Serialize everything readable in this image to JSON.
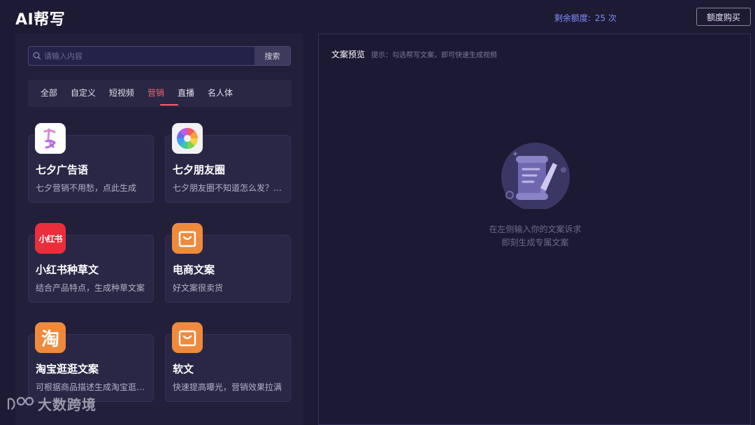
{
  "header": {
    "title": "AI帮写",
    "quota_label": "剩余额度:",
    "quota_value": "25 次",
    "buy_button": "额度购买"
  },
  "search": {
    "placeholder": "请输入内容",
    "button_label": "搜索"
  },
  "tabs": [
    {
      "label": "全部"
    },
    {
      "label": "自定义"
    },
    {
      "label": "短视频"
    },
    {
      "label": "营销",
      "active": true
    },
    {
      "label": "直播"
    },
    {
      "label": "名人体"
    }
  ],
  "cards": [
    {
      "title": "七夕广告语",
      "desc": "七夕营销不用愁，点此生成",
      "icon": "qixi-icon"
    },
    {
      "title": "七夕朋友圈",
      "desc": "七夕朋友圈不知道怎么发？点此生成",
      "icon": "aperture-icon"
    },
    {
      "title": "小红书种草文",
      "desc": "结合产品特点，生成种草文案",
      "icon": "xiaohongshu-icon",
      "icon_text": "小红书"
    },
    {
      "title": "电商文案",
      "desc": "好文案很卖货",
      "icon": "shopping-bag-icon"
    },
    {
      "title": "淘宝逛逛文案",
      "desc": "可根据商品描述生成淘宝逛逛文案",
      "icon": "taobao-icon",
      "icon_text": "淘"
    },
    {
      "title": "软文",
      "desc": "快速提高曝光，营销效果拉满",
      "icon": "shopping-bag-icon"
    }
  ],
  "preview": {
    "title": "文案预览",
    "hint": "提示：勾选帮写文案，即可快速生成视频",
    "empty_line1": "在左侧输入你的文案诉求",
    "empty_line2": "即刻生成专属文案",
    "illustration_icon": "scroll-pen-icon"
  },
  "watermark": {
    "text": "大数跨境",
    "icon": "brand-logo-icon"
  },
  "colors": {
    "background": "#1d1a33",
    "accent_active": "#ff5d6d",
    "quota": "#7f8cff",
    "xiaohongshu": "#ea2e3c",
    "orange": "#ef8a3c"
  }
}
